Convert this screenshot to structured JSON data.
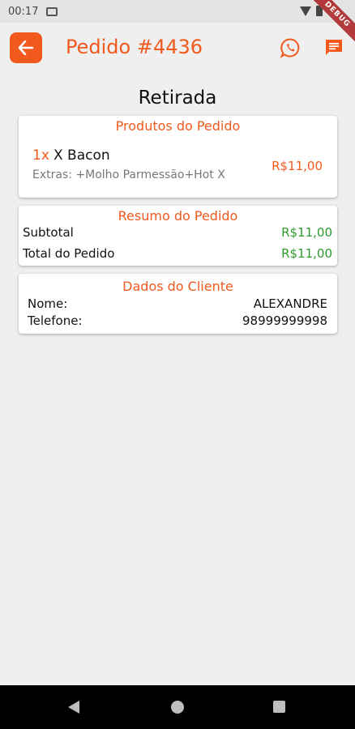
{
  "status_bar": {
    "time": "00:17",
    "icons": [
      "sim-card-icon",
      "wifi-icon",
      "battery-icon"
    ]
  },
  "debug_banner": "DEBUG",
  "app_bar": {
    "title": "Pedido #4436",
    "icons": [
      "back-arrow-icon",
      "whatsapp-icon",
      "chat-message-icon"
    ]
  },
  "order": {
    "type": "Retirada"
  },
  "products_card": {
    "title": "Produtos do Pedido",
    "items": [
      {
        "qty": "1x",
        "name": "X Bacon",
        "extras": "Extras: +Molho Parmessão+Hot X",
        "price": "R$11,00"
      }
    ]
  },
  "summary_card": {
    "title": "Resumo do Pedido",
    "subtotal_label": "Subtotal",
    "subtotal_value": "R$11,00",
    "total_label": "Total do Pedido",
    "total_value": "R$11,00"
  },
  "client_card": {
    "title": "Dados do Cliente",
    "name_label": "Nome:",
    "name_value": "ALEXANDRE",
    "phone_label": "Telefone:",
    "phone_value": "98999999998"
  },
  "colors": {
    "accent": "#f2591d",
    "price_green": "#2e9a2e",
    "background": "#efefef"
  }
}
